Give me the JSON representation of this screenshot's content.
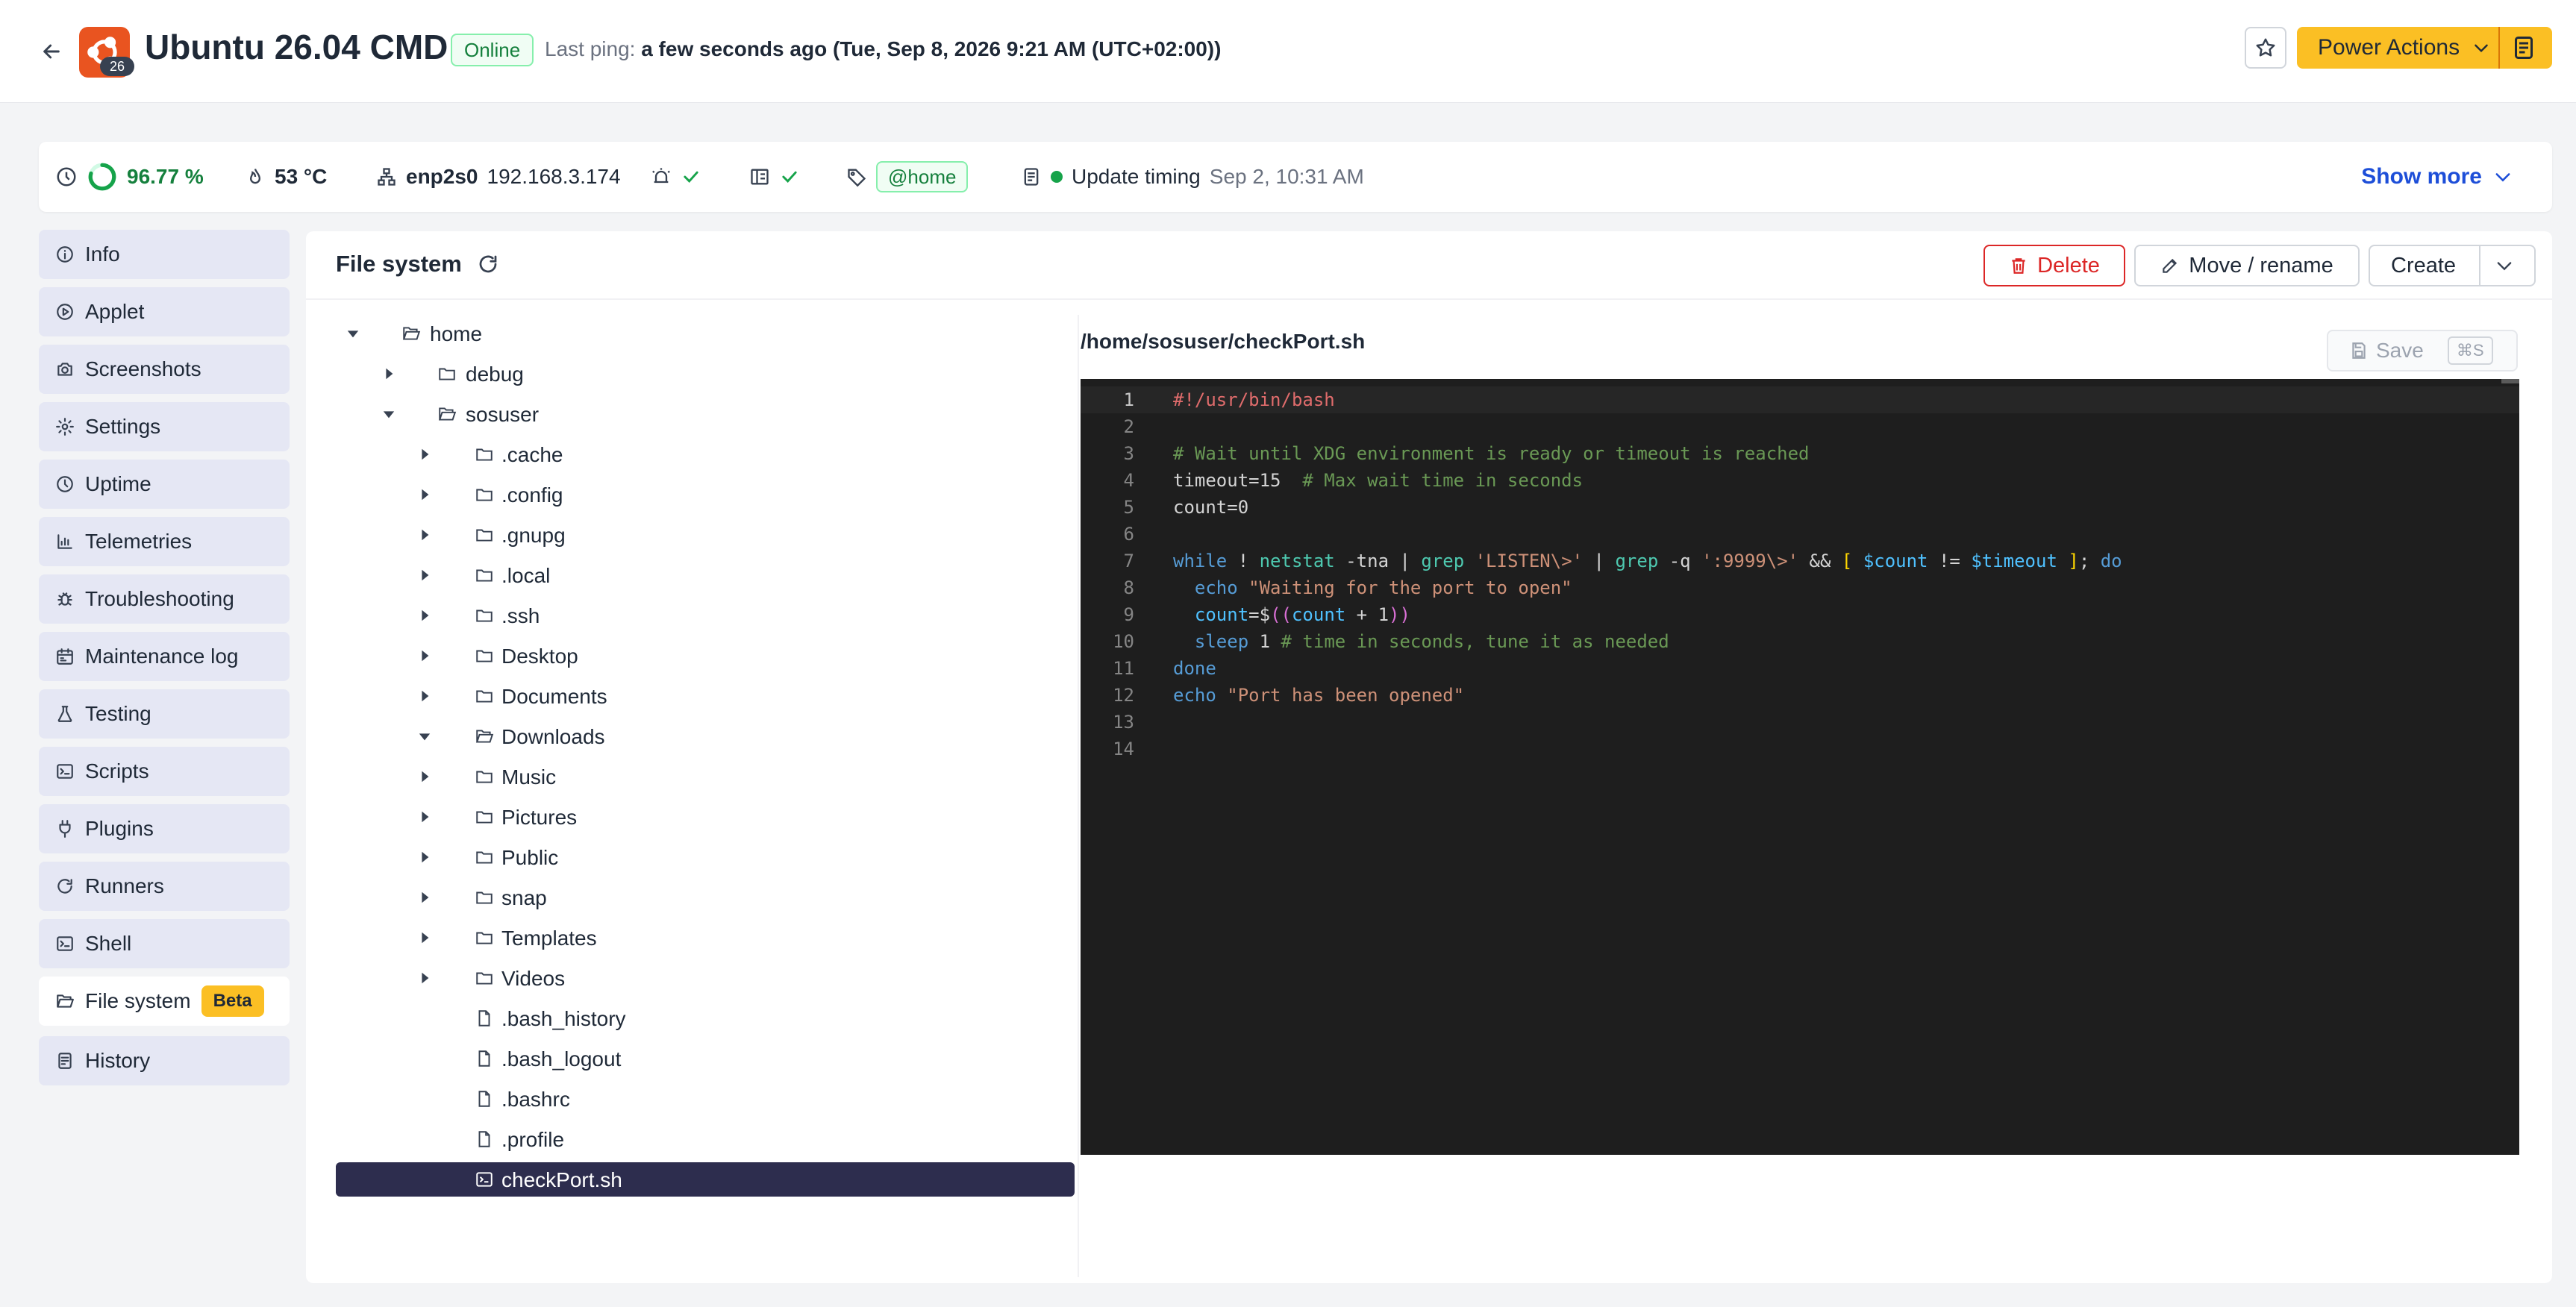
{
  "header": {
    "title": "Ubuntu 26.04 CMD",
    "logo_badge": "26",
    "status": "Online",
    "last_ping_label": "Last ping:",
    "last_ping_value": "a few seconds ago (Tue, Sep 8, 2026 9:21 AM (UTC+02:00))",
    "power_actions_label": "Power Actions"
  },
  "stats": {
    "cpu": "96.77 %",
    "temperature": "53 °C",
    "network_interface": "enp2s0",
    "ip_address": "192.168.3.174",
    "tag": "@home",
    "update_timing_label": "Update timing",
    "update_timing_value": "Sep 2, 10:31 AM",
    "show_more": "Show more"
  },
  "sidebar": {
    "items": [
      {
        "label": "Info",
        "icon": "info-icon"
      },
      {
        "label": "Applet",
        "icon": "play-circle-icon"
      },
      {
        "label": "Screenshots",
        "icon": "camera-icon"
      },
      {
        "label": "Settings",
        "icon": "gear-icon"
      },
      {
        "label": "Uptime",
        "icon": "clock-icon"
      },
      {
        "label": "Telemetries",
        "icon": "bar-chart-icon"
      },
      {
        "label": "Troubleshooting",
        "icon": "bug-icon"
      },
      {
        "label": "Maintenance log",
        "icon": "calendar-icon"
      },
      {
        "label": "Testing",
        "icon": "flask-icon"
      },
      {
        "label": "Scripts",
        "icon": "terminal-icon"
      },
      {
        "label": "Plugins",
        "icon": "plug-icon"
      },
      {
        "label": "Runners",
        "icon": "refresh-icon"
      },
      {
        "label": "Shell",
        "icon": "terminal-icon"
      },
      {
        "label": "File system",
        "icon": "folder-open-icon",
        "badge": "Beta",
        "active": true
      },
      {
        "label": "History",
        "icon": "history-icon"
      }
    ]
  },
  "main": {
    "title": "File system",
    "delete_label": "Delete",
    "move_label": "Move / rename",
    "create_label": "Create",
    "file_path": "/home/sosuser/checkPort.sh",
    "save_label": "Save",
    "save_shortcut": "⌘S",
    "tree": [
      {
        "label": "home",
        "type": "folder",
        "depth": 0,
        "expanded": true
      },
      {
        "label": "debug",
        "type": "folder",
        "depth": 1,
        "expanded": false
      },
      {
        "label": "sosuser",
        "type": "folder",
        "depth": 1,
        "expanded": true
      },
      {
        "label": ".cache",
        "type": "folder",
        "depth": 2,
        "expanded": false
      },
      {
        "label": ".config",
        "type": "folder",
        "depth": 2,
        "expanded": false
      },
      {
        "label": ".gnupg",
        "type": "folder",
        "depth": 2,
        "expanded": false
      },
      {
        "label": ".local",
        "type": "folder",
        "depth": 2,
        "expanded": false
      },
      {
        "label": ".ssh",
        "type": "folder",
        "depth": 2,
        "expanded": false
      },
      {
        "label": "Desktop",
        "type": "folder",
        "depth": 2,
        "expanded": false
      },
      {
        "label": "Documents",
        "type": "folder",
        "depth": 2,
        "expanded": false
      },
      {
        "label": "Downloads",
        "type": "folder",
        "depth": 2,
        "expanded": true
      },
      {
        "label": "Music",
        "type": "folder",
        "depth": 2,
        "expanded": false
      },
      {
        "label": "Pictures",
        "type": "folder",
        "depth": 2,
        "expanded": false
      },
      {
        "label": "Public",
        "type": "folder",
        "depth": 2,
        "expanded": false
      },
      {
        "label": "snap",
        "type": "folder",
        "depth": 2,
        "expanded": false
      },
      {
        "label": "Templates",
        "type": "folder",
        "depth": 2,
        "expanded": false
      },
      {
        "label": "Videos",
        "type": "folder",
        "depth": 2,
        "expanded": false
      },
      {
        "label": ".bash_history",
        "type": "file",
        "depth": 2
      },
      {
        "label": ".bash_logout",
        "type": "file",
        "depth": 2
      },
      {
        "label": ".bashrc",
        "type": "file",
        "depth": 2
      },
      {
        "label": ".profile",
        "type": "file",
        "depth": 2
      },
      {
        "label": "checkPort.sh",
        "type": "script",
        "depth": 2,
        "selected": true
      }
    ],
    "code_lines": [
      "#!/usr/bin/bash",
      "",
      "# Wait until XDG environment is ready or timeout is reached",
      "timeout=15  # Max wait time in seconds",
      "count=0",
      "",
      "while ! netstat -tna | grep 'LISTEN\\>' | grep -q ':9999\\>' && [ $count != $timeout ]; do",
      "  echo \"Waiting for the port to open\"",
      "  count=$((count + 1))",
      "  sleep 1 # time in seconds, tune it as needed",
      "done",
      "echo \"Port has been opened\"",
      "",
      ""
    ]
  }
}
